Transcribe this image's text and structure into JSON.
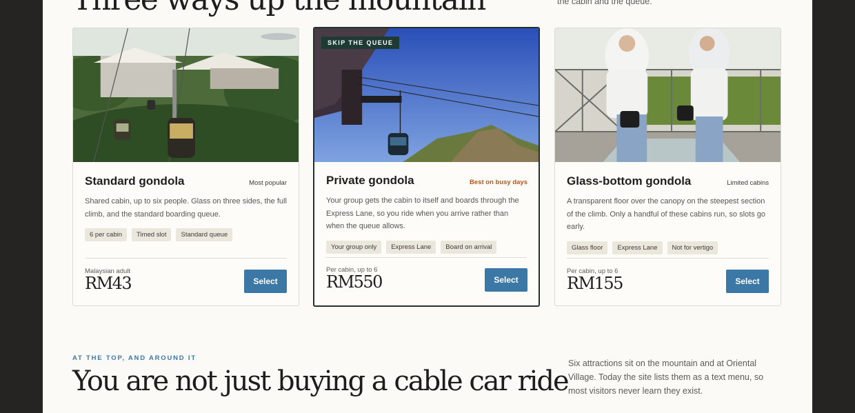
{
  "hero": {
    "title": "Three ways up the mountain",
    "note": "the cabin and the queue."
  },
  "cards": [
    {
      "name": "Standard gondola",
      "tag": "Most popular",
      "description": "Shared cabin, up to six people. Glass on three sides, the full climb, and the standard boarding queue.",
      "chips": [
        "6 per cabin",
        "Timed slot",
        "Standard queue"
      ],
      "price_label": "Malaysian adult",
      "price": "RM43",
      "button": "Select"
    },
    {
      "flag": "SKIP THE QUEUE",
      "name": "Private gondola",
      "tag": "Best on busy days",
      "description": "Your group gets the cabin to itself and boards through the Express Lane, so you ride when you arrive rather than when the queue allows.",
      "chips": [
        "Your group only",
        "Express Lane",
        "Board on arrival"
      ],
      "price_label": "Per cabin, up to 6",
      "price": "RM550",
      "button": "Select"
    },
    {
      "name": "Glass-bottom gondola",
      "tag": "Limited cabins",
      "description": "A transparent floor over the canopy on the steepest section of the climb. Only a handful of these cabins run, so slots go early.",
      "chips": [
        "Glass floor",
        "Express Lane",
        "Not for vertigo"
      ],
      "price_label": "Per cabin, up to 6",
      "price": "RM155",
      "button": "Select"
    }
  ],
  "section": {
    "eyebrow": "AT THE TOP, AND AROUND IT",
    "title": "You are not just buying a cable car ride",
    "note": "Six attractions sit on the mountain and at Oriental Village. Today the site lists them as a text menu, so most visitors never learn they exist."
  },
  "colors": {
    "accent": "#3b78a6",
    "flag": "#1e3b33",
    "warn": "#b4571f",
    "page": "#fbfaf6",
    "frame": "#252422"
  }
}
